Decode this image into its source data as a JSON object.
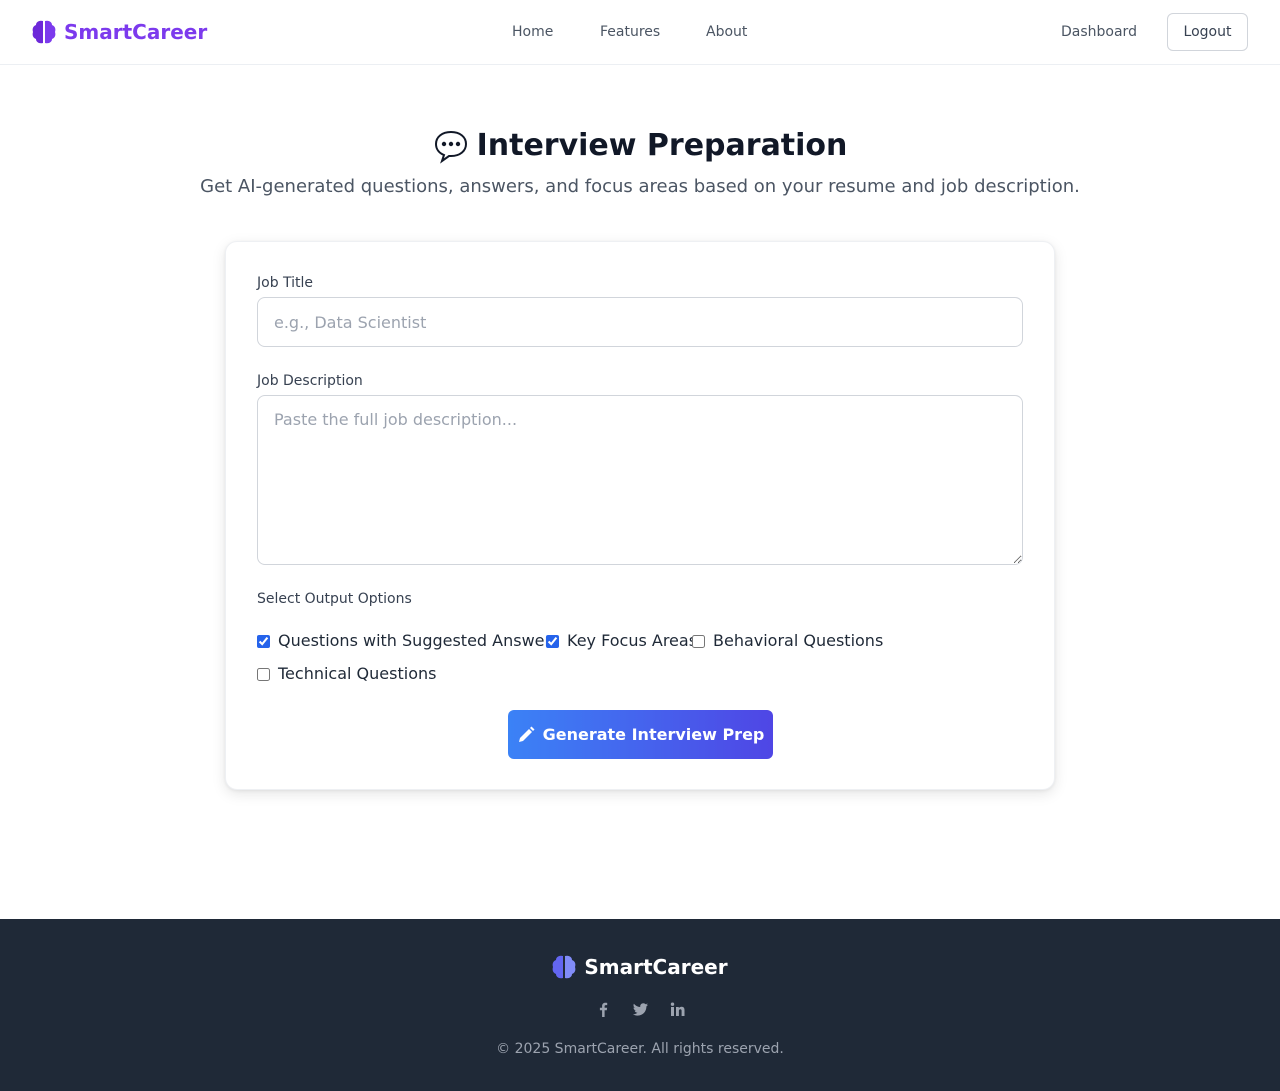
{
  "colors": {
    "brand": "#7c3aed",
    "primary_gradient_start": "#3b82f6",
    "primary_gradient_end": "#4f46e5",
    "footer_bg": "#1f2937",
    "footer_brand_icon": "#818cf8"
  },
  "nav": {
    "brand_icon": "brain-icon",
    "brand_name": "SmartCareer",
    "links": [
      "Home",
      "Features",
      "About"
    ],
    "dashboard_label": "Dashboard",
    "logout_label": "Logout"
  },
  "header": {
    "title_icon": "speech-bubble-icon",
    "title": "Interview Preparation",
    "subtitle": "Get AI-generated questions, answers, and focus areas based on your resume and job description."
  },
  "form": {
    "job_title": {
      "label": "Job Title",
      "value": "",
      "placeholder": "e.g., Data Scientist"
    },
    "job_description": {
      "label": "Job Description",
      "value": "",
      "placeholder": "Paste the full job description..."
    },
    "options_label": "Select Output Options",
    "options": [
      {
        "label": "Questions with Suggested Answers",
        "checked": true
      },
      {
        "label": "Key Focus Areas",
        "checked": true
      },
      {
        "label": "Behavioral Questions",
        "checked": false
      },
      {
        "label": "Technical Questions",
        "checked": false
      }
    ],
    "submit_icon": "pencil-icon",
    "submit_label": "Generate Interview Prep"
  },
  "footer": {
    "brand_icon": "brain-icon",
    "brand_name": "SmartCareer",
    "socials": [
      "facebook-icon",
      "twitter-icon",
      "linkedin-icon"
    ],
    "copyright": "© 2025 SmartCareer. All rights reserved."
  }
}
